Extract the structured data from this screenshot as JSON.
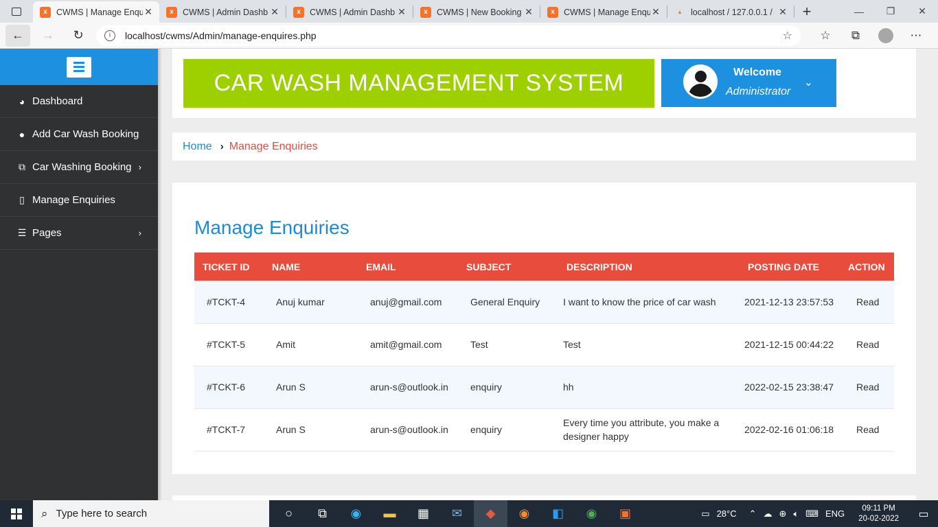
{
  "browser": {
    "tabs": [
      {
        "label": "CWMS | Manage Enqu",
        "active": true,
        "icon": "xampp-icon"
      },
      {
        "label": "CWMS | Admin Dashb",
        "active": false,
        "icon": "xampp-icon"
      },
      {
        "label": "CWMS | Admin Dashb",
        "active": false,
        "icon": "xampp-icon"
      },
      {
        "label": "CWMS | New Booking",
        "active": false,
        "icon": "xampp-icon"
      },
      {
        "label": "CWMS | Manage Enqu",
        "active": false,
        "icon": "xampp-icon"
      },
      {
        "label": "localhost / 127.0.0.1 /",
        "active": false,
        "icon": "phpmyadmin-icon"
      }
    ],
    "url": "localhost/cwms/Admin/manage-enquires.php"
  },
  "sidebar": {
    "items": [
      {
        "label": "Dashboard",
        "icon": "dashboard-icon",
        "has_submenu": false
      },
      {
        "label": "Add Car Wash Booking",
        "icon": "user-icon",
        "has_submenu": false
      },
      {
        "label": "Car Washing Booking",
        "icon": "copy-icon",
        "has_submenu": true
      },
      {
        "label": "Manage Enquiries",
        "icon": "file-icon",
        "has_submenu": false
      },
      {
        "label": "Pages",
        "icon": "list-icon",
        "has_submenu": true
      }
    ]
  },
  "header": {
    "banner": "CAR WASH MANAGEMENT SYSTEM",
    "welcome": "Welcome",
    "user": "Administrator"
  },
  "breadcrumb": {
    "home": "Home",
    "current": "Manage Enquiries"
  },
  "main": {
    "title": "Manage Enquiries",
    "table": {
      "headers": [
        "TICKET ID",
        "NAME",
        "EMAIL",
        "SUBJECT",
        "DESCRIPTION",
        "POSTING DATE",
        "ACTION"
      ],
      "rows": [
        {
          "ticket": "#TCKT-4",
          "name": "Anuj kumar",
          "email": "anuj@gmail.com",
          "subject": "General Enquiry",
          "description": "I want to know the price of car wash",
          "date": "2021-12-13 23:57:53",
          "action": "Read"
        },
        {
          "ticket": "#TCKT-5",
          "name": "Amit",
          "email": "amit@gmail.com",
          "subject": "Test",
          "description": "Test",
          "date": "2021-12-15 00:44:22",
          "action": "Read"
        },
        {
          "ticket": "#TCKT-6",
          "name": "Arun S",
          "email": "arun-s@outlook.in",
          "subject": "enquiry",
          "description": "hh",
          "date": "2022-02-15 23:38:47",
          "action": "Read"
        },
        {
          "ticket": "#TCKT-7",
          "name": "Arun S",
          "email": "arun-s@outlook.in",
          "subject": "enquiry",
          "description": "Every time you attribute, you make a designer happy",
          "date": "2022-02-16 01:06:18",
          "action": "Read"
        }
      ]
    }
  },
  "taskbar": {
    "search_placeholder": "Type here to search",
    "temperature": "28°C",
    "language": "ENG",
    "time": "09:11 PM",
    "date": "20-02-2022"
  },
  "colors": {
    "sidebar_bg": "#2f3133",
    "accent_blue": "#1e90e0",
    "banner_green": "#9ed000",
    "table_header_red": "#e84c3d",
    "breadcrumb_current": "#e74c3c"
  }
}
